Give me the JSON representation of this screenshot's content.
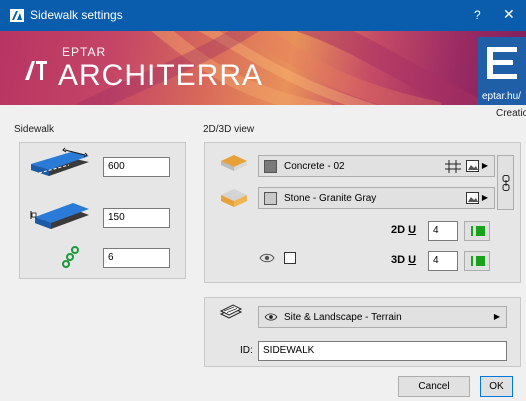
{
  "window": {
    "title": "Sidewalk settings",
    "help": "?",
    "close": "✕"
  },
  "banner": {
    "eptar": "EPTAR",
    "product": "ARCHITERRA",
    "url": "eptar.hu/",
    "creation": "Creatio"
  },
  "sidewalk": {
    "section_label": "Sidewalk",
    "width_value": "600",
    "height_value": "150",
    "segments_value": "6"
  },
  "view": {
    "section_label": "2D/3D view",
    "material_top": "Concrete - 02",
    "material_side": "Stone - Granite Gray",
    "pen_2d_label": "2D",
    "pen_2d_value": "4",
    "pen_3d_label": "3D",
    "pen_3d_value": "4",
    "colors": {
      "material_top_swatch": "#7a7a7a",
      "material_side_swatch": "#c8c8c8",
      "pen_green": "#1aa11a"
    }
  },
  "layer": {
    "layer_name": "Site & Landscape - Terrain",
    "id_label": "ID:",
    "id_value": "SIDEWALK"
  },
  "buttons": {
    "cancel": "Cancel",
    "ok": "OK"
  },
  "icons": {
    "app": "architerra-icon",
    "hatch": "hatch-icon",
    "texture": "texture-icon",
    "chain": "chain-link-icon",
    "eye": "eye-icon",
    "layer": "layer-stack-icon"
  }
}
